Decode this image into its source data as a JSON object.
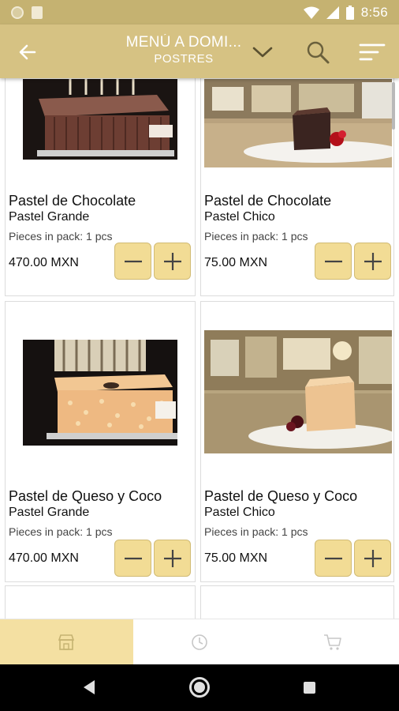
{
  "status_bar": {
    "time": "8:56"
  },
  "header": {
    "title": "MENÚ A DOMI...",
    "subtitle": "POSTRES"
  },
  "products": [
    {
      "name": "Pastel de Chocolate",
      "size": "Pastel Grande",
      "pack": "Pieces in pack: 1 pcs",
      "price": "470.00 MXN"
    },
    {
      "name": "Pastel de Chocolate",
      "size": "Pastel Chico",
      "pack": "Pieces in pack: 1 pcs",
      "price": "75.00 MXN"
    },
    {
      "name": "Pastel de Queso y Coco",
      "size": "Pastel Grande",
      "pack": "Pieces in pack: 1 pcs",
      "price": "470.00 MXN"
    },
    {
      "name": "Pastel de Queso y Coco",
      "size": "Pastel Chico",
      "pack": "Pieces in pack: 1 pcs",
      "price": "75.00 MXN"
    }
  ],
  "icons": {
    "back": "arrow-left-icon",
    "dropdown": "chevron-down-icon",
    "search": "search-icon",
    "filter": "filter-icon",
    "minus": "minus-icon",
    "plus": "plus-icon",
    "store": "store-icon",
    "history": "clock-icon",
    "cart": "cart-icon"
  },
  "colors": {
    "app_bar": "#d6c283",
    "status_bar": "#c5b271",
    "qty_button": "#f2dc95",
    "active_tab": "#f4e0a2"
  }
}
